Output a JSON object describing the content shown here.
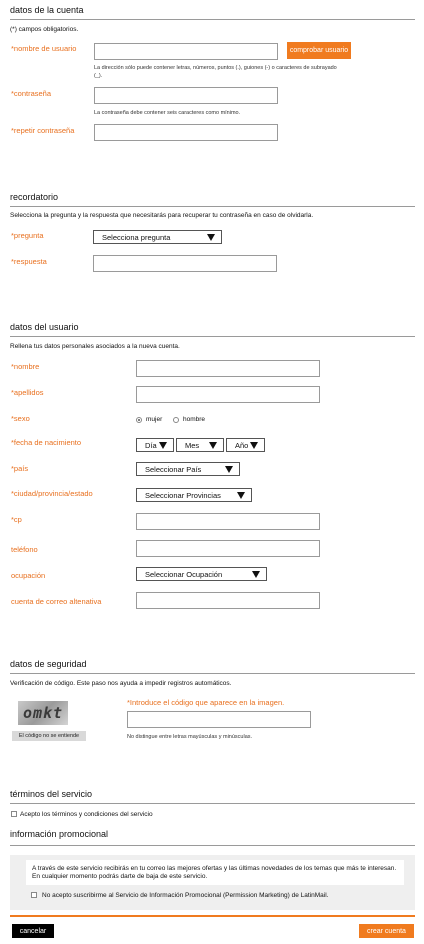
{
  "account": {
    "title": "datos de la cuenta",
    "required_note": "(*) campos obligatorios.",
    "username_label": "*nombre de usuario",
    "check_button": "comprobar usuario",
    "username_hint": "La dirección sólo puede contener letras, números, puntos (.), guiones (-) o caracteres de subrayado (_).",
    "password_label": "*contraseña",
    "password_hint": "La contraseña debe contener seis caracteres como mínimo.",
    "repeat_password_label": "*repetir contraseña"
  },
  "reminder": {
    "title": "recordatorio",
    "note": "Selecciona la pregunta y la respuesta que necesitarás para recuperar tu contraseña en caso de olvidarla.",
    "question_label": "*pregunta",
    "question_select": "Selecciona pregunta",
    "answer_label": "*respuesta"
  },
  "user": {
    "title": "datos del usuario",
    "note": "Rellena tus datos personales asociados a la nueva cuenta.",
    "name_label": "*nombre",
    "surname_label": "*apellidos",
    "sex_label": "*sexo",
    "sex_female": "mujer",
    "sex_male": "hombre",
    "birth_label": "*fecha de nacimiento",
    "day_select": "Día",
    "month_select": "Mes",
    "year_select": "Año",
    "country_label": "*país",
    "country_select": "Seleccionar País",
    "city_label": "*ciudad/provincia/estado",
    "province_select": "Seleccionar Provincias",
    "zip_label": "*cp",
    "phone_label": "teléfono",
    "occupation_label": "ocupación",
    "occupation_select": "Seleccionar Ocupación",
    "alt_email_label": "cuenta de correo altenativa"
  },
  "security": {
    "title": "datos de seguridad",
    "note": "Verificación de código. Este paso nos ayuda a impedir registros automáticos.",
    "captcha_text": "omkt",
    "cant_read": "El código no se entiende",
    "code_label": "*Introduce el código que aparece en la imagen.",
    "code_hint": "No distingue entre letras mayúsculas y minúsculas."
  },
  "terms": {
    "title": "términos del servicio",
    "accept": "Acepto los términos y condiciones del servicio"
  },
  "promo": {
    "title": "información promocional",
    "text": "A través de este servicio recibirás en tu correo las mejores ofertas y las últimas novedades de los temas que más te interesan. En cualquier momento podrás darte de baja de este servicio.",
    "decline": "No acepto suscribirme al Servicio de Información Promocional (Permission Marketing) de LatinMail."
  },
  "actions": {
    "cancel": "cancelar",
    "create": "crear cuenta"
  },
  "colors": {
    "accent": "#f07b1f",
    "label": "#e8701f"
  }
}
